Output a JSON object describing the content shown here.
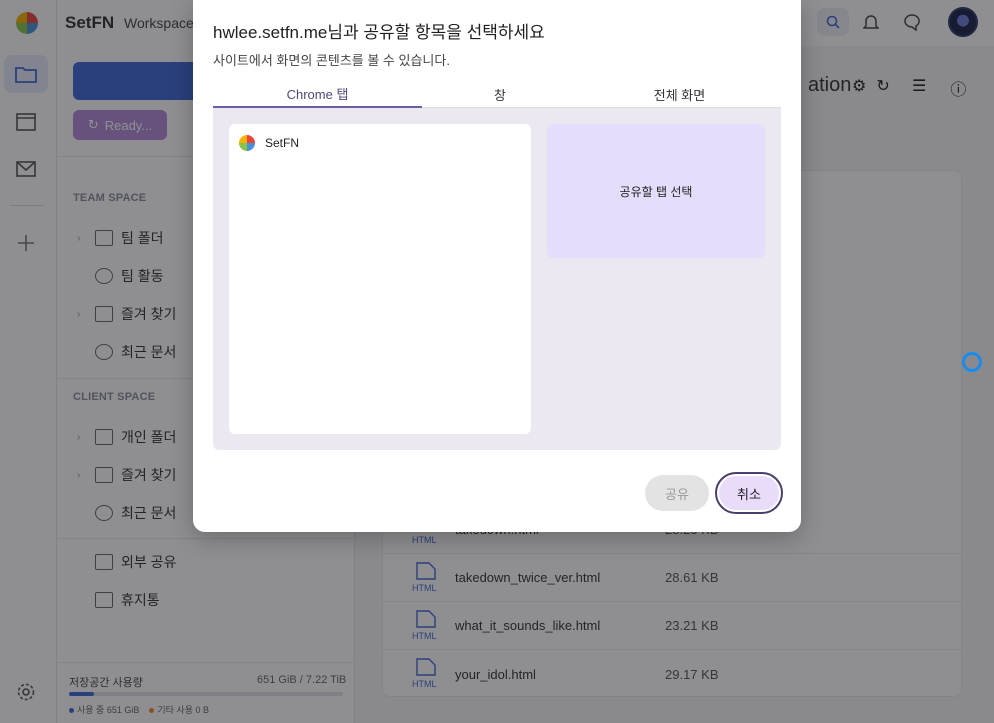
{
  "app": {
    "brand": "SetFN",
    "workspace": "Workspace"
  },
  "sidebar": {
    "ready_label": "Ready...",
    "team_space": "TEAM SPACE",
    "team_items": [
      {
        "label": "팀 폴더"
      },
      {
        "label": "팀 활동"
      },
      {
        "label": "즐겨 찾기"
      },
      {
        "label": "최근 문서"
      }
    ],
    "client_space": "CLIENT SPACE",
    "client_items": [
      {
        "label": "개인 폴더"
      },
      {
        "label": "즐겨 찾기"
      },
      {
        "label": "최근 문서"
      }
    ],
    "extra_items": [
      {
        "label": "외부 공유"
      },
      {
        "label": "휴지통"
      }
    ],
    "storage": {
      "title": "저장공간 사용량",
      "value": "651 GiB / 7.22 TiB",
      "used_fraction": 0.09,
      "used_label": "사용 중 651 GiB",
      "other_label": "기타 사용 0 B",
      "used_color": "#3f68d6",
      "other_color": "#f08a24"
    }
  },
  "main": {
    "title_fragment": "ation",
    "files": [
      {
        "type": "HTML",
        "name": "takedown.html",
        "size": "28.23 KB"
      },
      {
        "type": "HTML",
        "name": "takedown_twice_ver.html",
        "size": "28.61 KB"
      },
      {
        "type": "HTML",
        "name": "what_it_sounds_like.html",
        "size": "23.21 KB"
      },
      {
        "type": "HTML",
        "name": "your_idol.html",
        "size": "29.17 KB"
      }
    ]
  },
  "dialog": {
    "title": "hwlee.setfn.me님과 공유할 항목을 선택하세요",
    "subtitle": "사이트에서 화면의 콘텐츠를 볼 수 있습니다.",
    "tabs": [
      {
        "label": "Chrome 탭",
        "active": true
      },
      {
        "label": "창",
        "active": false
      },
      {
        "label": "전체 화면",
        "active": false
      }
    ],
    "tab_entries": [
      {
        "label": "SetFN"
      }
    ],
    "preview_label": "공유할 탭 선택",
    "share_label": "공유",
    "cancel_label": "취소",
    "accent_color": "#6b5f9e"
  }
}
